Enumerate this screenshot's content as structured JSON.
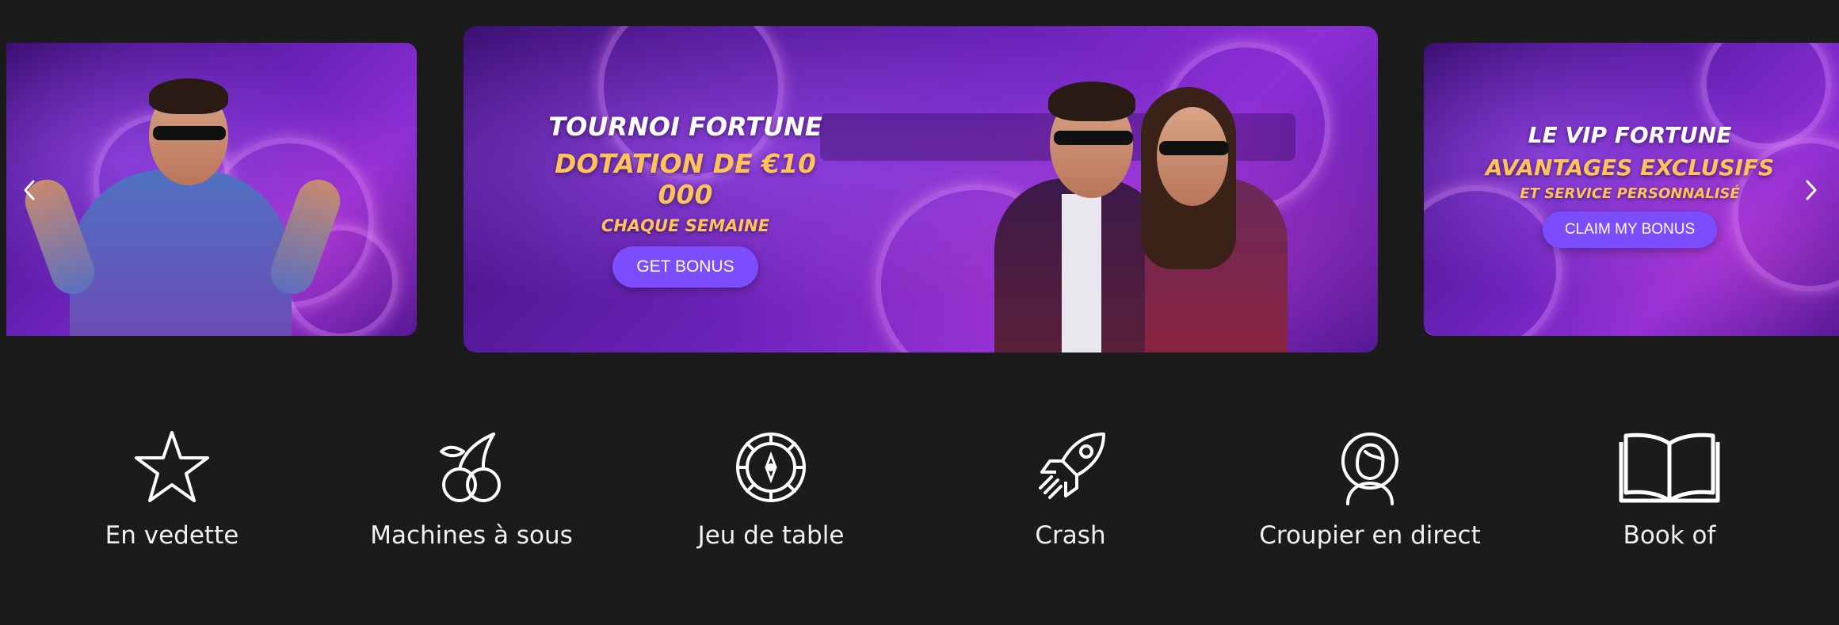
{
  "carousel": {
    "slides": [
      {
        "id": "slide-left",
        "title": "",
        "button": ""
      },
      {
        "id": "slide-center",
        "title": "TOURNOI FORTUNE",
        "subtitle": "DOTATION DE €10 000",
        "tagline": "CHAQUE SEMAINE",
        "button": "GET BONUS"
      },
      {
        "id": "slide-right",
        "title": "LE VIP FORTUNE",
        "subtitle": "AVANTAGES EXCLUSIFS",
        "tagline": "ET SERVICE PERSONNALISÉ",
        "button": "CLAIM MY BONUS"
      }
    ],
    "prev_icon": "chevron-left-icon",
    "next_icon": "chevron-right-icon"
  },
  "categories": [
    {
      "label": "En vedette",
      "icon": "star-icon"
    },
    {
      "label": "Machines à sous",
      "icon": "cherries-icon"
    },
    {
      "label": "Jeu de table",
      "icon": "roulette-icon"
    },
    {
      "label": "Crash",
      "icon": "rocket-icon"
    },
    {
      "label": "Croupier en direct",
      "icon": "dealer-icon"
    },
    {
      "label": "Book of",
      "icon": "book-icon"
    }
  ],
  "colors": {
    "background": "#1b1b1b",
    "accent_button": "#7b4dff",
    "promo_gold": "#ffc35a",
    "slide_purple": "#6a22b8"
  }
}
